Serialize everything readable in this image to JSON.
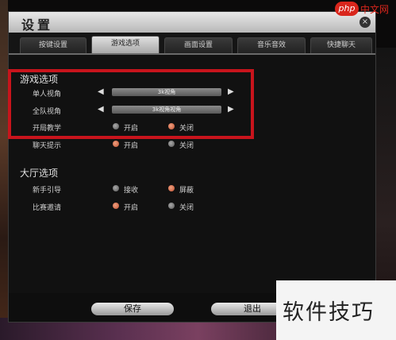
{
  "dialog": {
    "title": "设置",
    "close_symbol": "×"
  },
  "tabs": [
    {
      "label": "按键设置"
    },
    {
      "label": "游戏选项"
    },
    {
      "label": "画面设置"
    },
    {
      "label": "音乐音效"
    },
    {
      "label": "快捷聊天"
    }
  ],
  "game_options": {
    "section_title": "游戏选项",
    "single_view": {
      "label": "单人视角",
      "value": "3k视角"
    },
    "team_view": {
      "label": "全队视角",
      "value": "3k视角视角"
    },
    "tutorial": {
      "label": "开局教学",
      "opt1": "开启",
      "opt2": "关闭",
      "selected": "关闭"
    },
    "chat_tips": {
      "label": "聊天提示",
      "opt1": "开启",
      "opt2": "关闭",
      "selected": "开启"
    }
  },
  "lobby_options": {
    "section_title": "大厅选项",
    "newbie_guide": {
      "label": "新手引导",
      "opt1": "接收",
      "opt2": "屏蔽",
      "selected": "屏蔽"
    },
    "match_invite": {
      "label": "比赛邀请",
      "opt1": "开启",
      "opt2": "关闭",
      "selected": "开启"
    }
  },
  "footer": {
    "save_label": "保存",
    "exit_label": "退出"
  },
  "arrows": {
    "left": "◀",
    "right": "▶"
  },
  "watermark": {
    "site_logo": "php",
    "site_text": "中文网",
    "caption": "软件技巧"
  },
  "colors": {
    "highlight_box": "#c8141c",
    "radio_on": "#c05030",
    "radio_off": "#777777"
  }
}
